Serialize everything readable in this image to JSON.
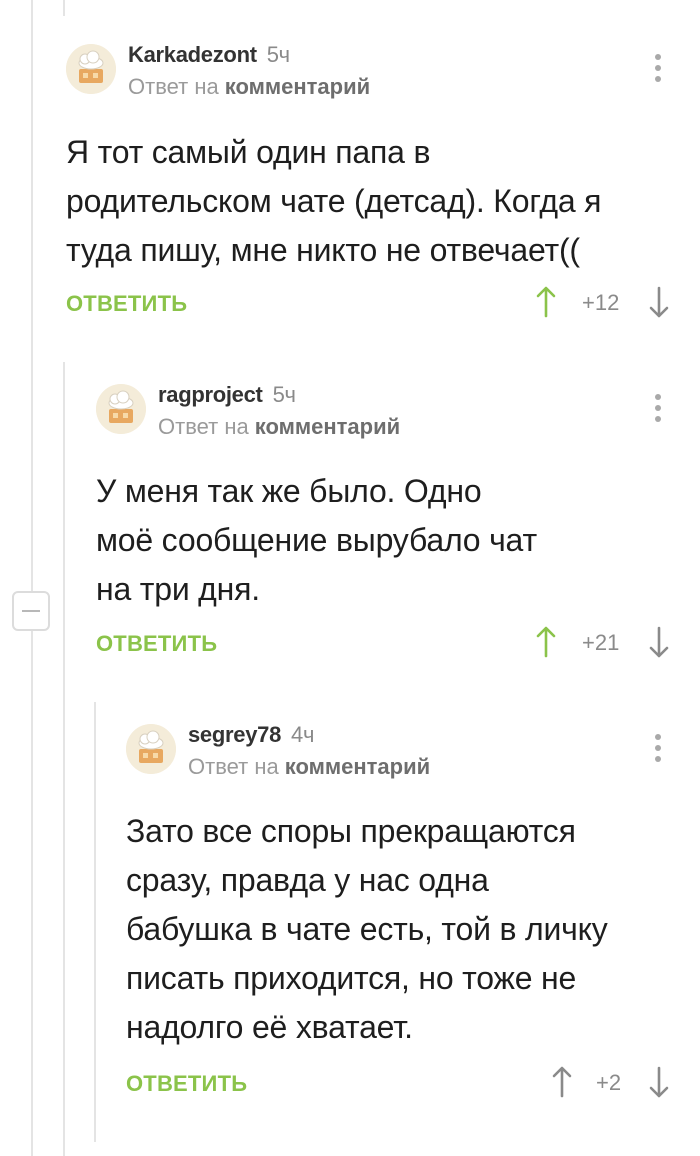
{
  "comments": [
    {
      "author": "Karkadezont",
      "time": "5ч",
      "reply_prefix": "Ответ на",
      "reply_link": "комментарий",
      "text_lines": [
        "Я тот самый один папа в",
        "родительском чате (детсад). Когда я",
        "туда пишу, мне никто не отвечает(("
      ],
      "reply_label": "ОТВЕТИТЬ",
      "rating": "+12",
      "upvote_color": "#8bc34a"
    },
    {
      "author": "ragproject",
      "time": "5ч",
      "reply_prefix": "Ответ на",
      "reply_link": "комментарий",
      "text_lines": [
        "У меня так же было. Одно",
        "моё сообщение вырубало чат",
        "на три дня."
      ],
      "reply_label": "ОТВЕТИТЬ",
      "rating": "+21",
      "upvote_color": "#8bc34a"
    },
    {
      "author": "segrey78",
      "time": "4ч",
      "reply_prefix": "Ответ на",
      "reply_link": "комментарий",
      "text_lines": [
        "Зато все споры прекращаются",
        "сразу, правда у нас одна",
        "бабушка в чате есть, той в личку",
        "писать приходится, но тоже не",
        "надолго её хватает."
      ],
      "reply_label": "ОТВЕТИТЬ",
      "rating": "+2",
      "upvote_color": "#8a8a8a"
    }
  ],
  "colors": {
    "accent": "#8bc34a",
    "muted": "#8a8a8a",
    "thread_line": "#e4e4e4"
  },
  "icons": {
    "more": "more-vertical-icon",
    "upvote": "arrow-up-icon",
    "downvote": "arrow-down-icon",
    "collapse": "minus-icon"
  }
}
